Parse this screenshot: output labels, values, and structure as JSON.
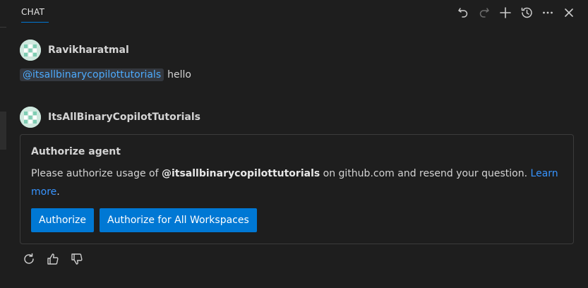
{
  "header": {
    "tab_label": "CHAT",
    "actions": [
      {
        "name": "undo-icon",
        "label": "Undo"
      },
      {
        "name": "redo-icon",
        "label": "Redo"
      },
      {
        "name": "new-chat-icon",
        "label": "New Chat"
      },
      {
        "name": "history-icon",
        "label": "Show Chats"
      },
      {
        "name": "more-icon",
        "label": "More Actions"
      },
      {
        "name": "close-icon",
        "label": "Close"
      }
    ]
  },
  "user_message": {
    "author": "Ravikharatmal",
    "mention": "@itsallbinarycopilottutorials",
    "text": "hello"
  },
  "agent_message": {
    "author": "ItsAllBinaryCopilotTutorials",
    "card": {
      "title": "Authorize agent",
      "body_prefix": "Please authorize usage of ",
      "body_bold": "@itsallbinarycopilottutorials",
      "body_suffix": " on github.com and resend your question. ",
      "link_text": "Learn more",
      "body_end": ".",
      "buttons": {
        "authorize": "Authorize",
        "authorize_all": "Authorize for All Workspaces"
      }
    }
  },
  "feedback": [
    "retry-icon",
    "thumbs-up-icon",
    "thumbs-down-icon"
  ],
  "colors": {
    "background": "#1e1e1e",
    "accent": "#0078d4",
    "link": "#3794ff",
    "mention": "#4daafc"
  }
}
